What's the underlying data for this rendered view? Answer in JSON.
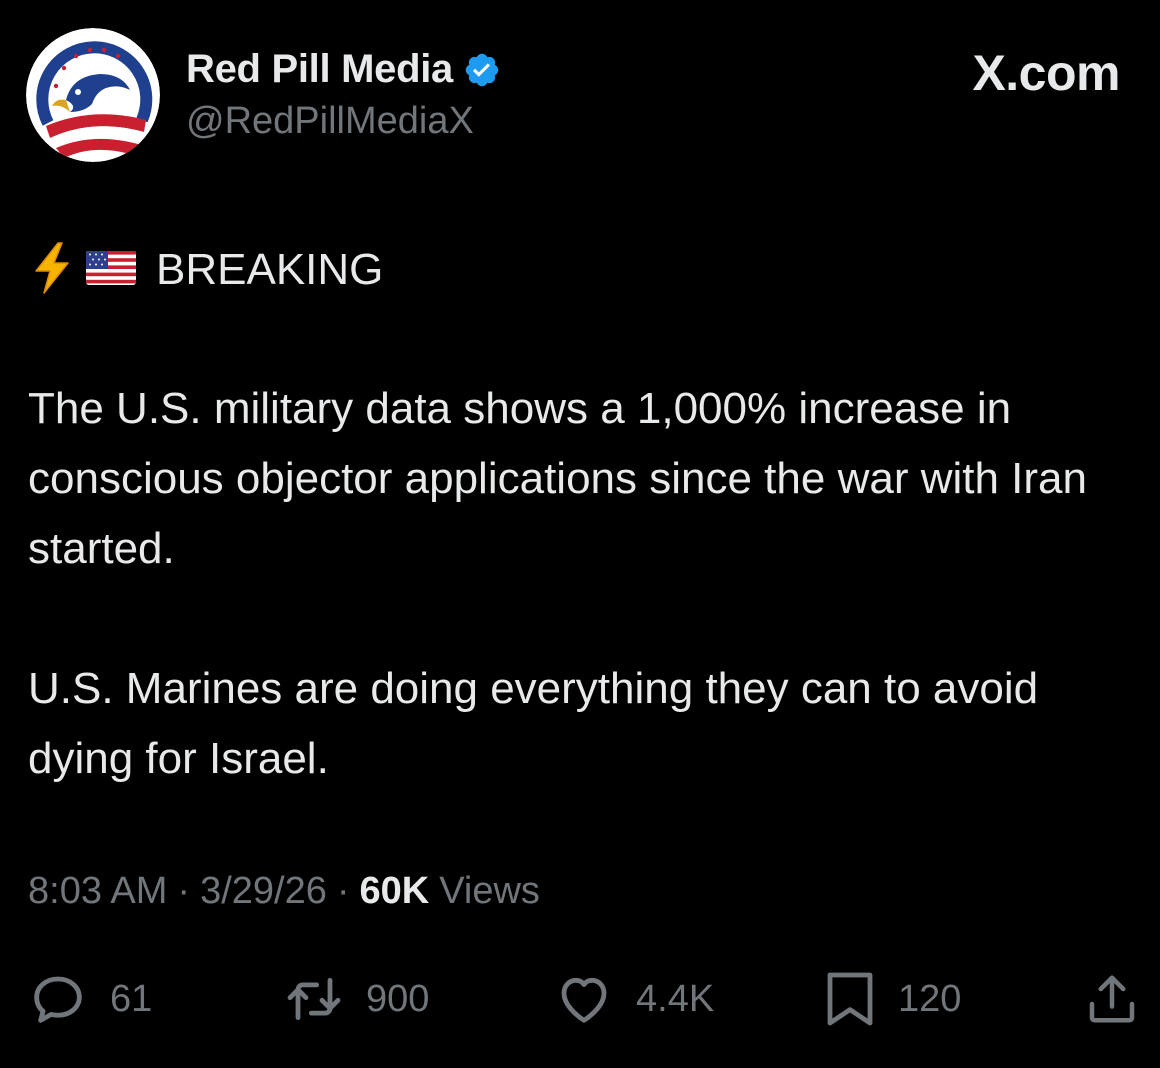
{
  "author": {
    "display_name": "Red Pill Media",
    "handle": "@RedPillMediaX",
    "verified": true
  },
  "brand": "X.com",
  "tweet": {
    "headline_emoji": [
      "high-voltage-emoji",
      "us-flag-emoji"
    ],
    "headline": "BREAKING",
    "paragraph_1": "The U.S. military data shows a 1,000% increase in conscious objector applications since the war with Iran started.",
    "paragraph_2": "U.S. Marines are doing everything they can to avoid dying for Israel."
  },
  "meta": {
    "time": "8:03 AM",
    "separator": "·",
    "date": "3/29/26",
    "views_count": "60K",
    "views_label": "Views"
  },
  "actions": {
    "replies": "61",
    "reposts": "900",
    "likes": "4.4K",
    "bookmarks": "120"
  },
  "colors": {
    "background": "#000000",
    "text_primary": "#e7e9ea",
    "text_secondary": "#71767b",
    "verified_blue": "#1d9bf0"
  }
}
